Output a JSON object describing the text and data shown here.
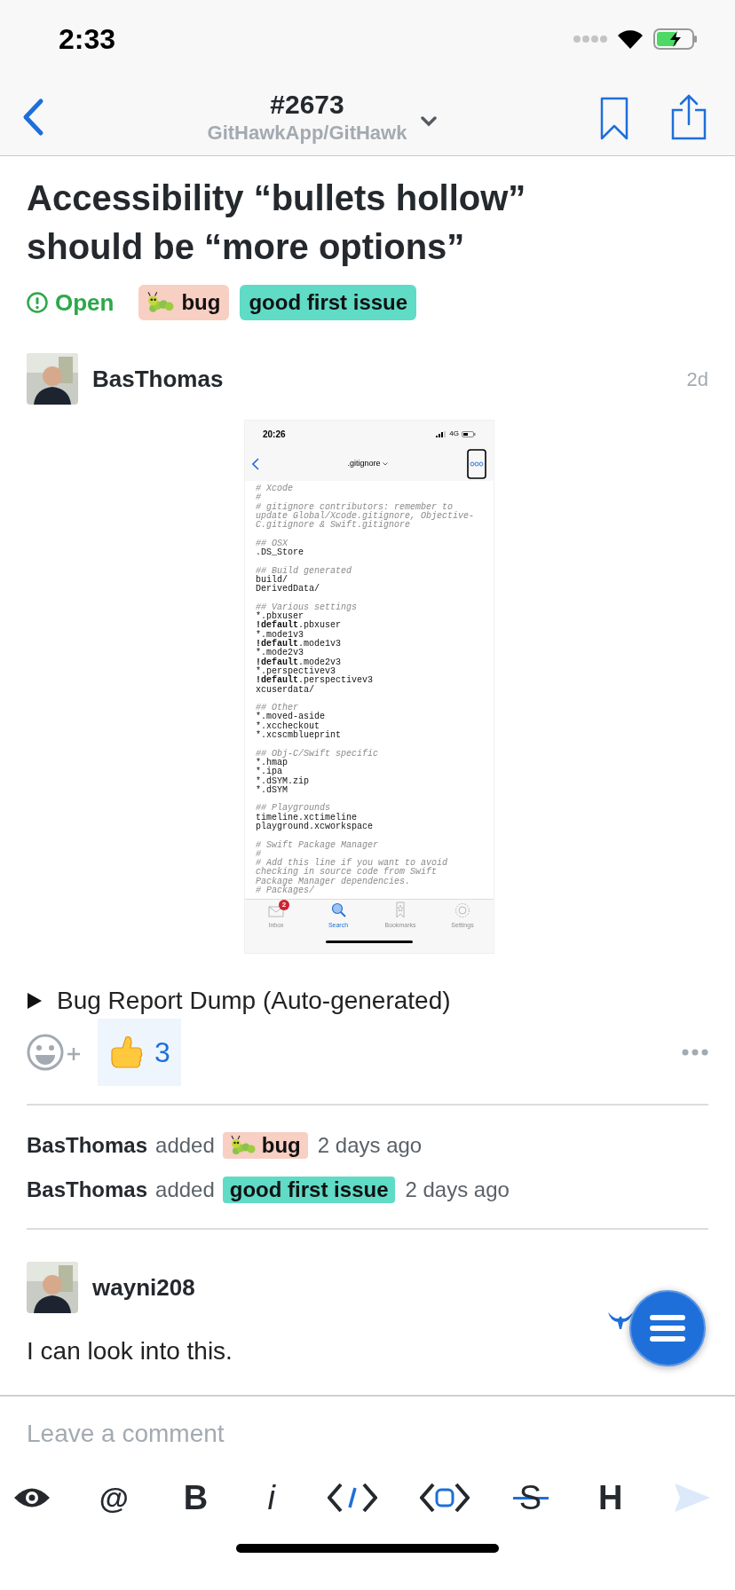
{
  "status_bar": {
    "time": "2:33"
  },
  "nav": {
    "title": "#2673",
    "subtitle": "GitHawkApp/GitHawk"
  },
  "issue": {
    "title": "Accessibility “bullets hollow” should be “more options”",
    "state": "Open",
    "labels": [
      {
        "name": "bug",
        "color": "#f8cfc3",
        "has_icon": true
      },
      {
        "name": "good first issue",
        "color": "#5fdbc6",
        "has_icon": false
      }
    ]
  },
  "comment": {
    "author": "BasThomas",
    "time": "2d",
    "screenshot": {
      "time": "20:26",
      "network": "4G",
      "title": ".gitignore",
      "code": [
        [
          {
            "kind": "comment",
            "text": "# Xcode"
          },
          {
            "kind": "comment",
            "text": "#"
          },
          {
            "kind": "comment",
            "text": "# gitignore contributors: remember to"
          },
          {
            "kind": "comment",
            "text": "update Global/Xcode.gitignore, Objective-"
          },
          {
            "kind": "comment",
            "text": "C.gitignore & Swift.gitignore"
          }
        ],
        [
          {
            "kind": "comment",
            "text": "## OSX"
          },
          {
            "kind": "code",
            "text": ".DS_Store"
          }
        ],
        [
          {
            "kind": "comment",
            "text": "## Build generated"
          },
          {
            "kind": "code",
            "text": "build/"
          },
          {
            "kind": "code",
            "text": "DerivedData/"
          }
        ],
        [
          {
            "kind": "comment",
            "text": "## Various settings"
          },
          {
            "kind": "code",
            "text": "*.pbxuser"
          },
          {
            "kind": "code",
            "bold": "!default",
            "text": ".pbxuser"
          },
          {
            "kind": "code",
            "text": "*.mode1v3"
          },
          {
            "kind": "code",
            "bold": "!default",
            "text": ".mode1v3"
          },
          {
            "kind": "code",
            "text": "*.mode2v3"
          },
          {
            "kind": "code",
            "bold": "!default",
            "text": ".mode2v3"
          },
          {
            "kind": "code",
            "text": "*.perspectivev3"
          },
          {
            "kind": "code",
            "bold": "!default",
            "text": ".perspectivev3"
          },
          {
            "kind": "code",
            "text": "xcuserdata/"
          }
        ],
        [
          {
            "kind": "comment",
            "text": "## Other"
          },
          {
            "kind": "code",
            "text": "*.moved-aside"
          },
          {
            "kind": "code",
            "text": "*.xccheckout"
          },
          {
            "kind": "code",
            "text": "*.xcscmblueprint"
          }
        ],
        [
          {
            "kind": "comment",
            "text": "## Obj-C/Swift specific"
          },
          {
            "kind": "code",
            "text": "*.hmap"
          },
          {
            "kind": "code",
            "text": "*.ipa"
          },
          {
            "kind": "code",
            "text": "*.dSYM.zip"
          },
          {
            "kind": "code",
            "text": "*.dSYM"
          }
        ],
        [
          {
            "kind": "comment",
            "text": "## Playgrounds"
          },
          {
            "kind": "code",
            "text": "timeline.xctimeline"
          },
          {
            "kind": "code",
            "text": "playground.xcworkspace"
          }
        ],
        [
          {
            "kind": "comment",
            "text": "# Swift Package Manager"
          },
          {
            "kind": "comment",
            "text": "#"
          },
          {
            "kind": "comment",
            "text": "# Add this line if you want to avoid"
          },
          {
            "kind": "comment",
            "text": "checking in source code from Swift"
          },
          {
            "kind": "comment",
            "text": "Package Manager dependencies."
          },
          {
            "kind": "comment",
            "text": "# Packages/"
          }
        ]
      ],
      "tabs": [
        {
          "label": "Inbox",
          "badge": "2",
          "selected": false
        },
        {
          "label": "Search",
          "selected": true
        },
        {
          "label": "Bookmarks",
          "selected": false
        },
        {
          "label": "Settings",
          "selected": false
        }
      ]
    },
    "details": "Bug Report Dump (Auto-generated)",
    "reactions": [
      {
        "count": "3"
      }
    ]
  },
  "events": [
    {
      "actor": "BasThomas",
      "action": "added",
      "label": {
        "name": "bug",
        "color": "#f8cfc3",
        "has_icon": true
      },
      "time": "2 days ago"
    },
    {
      "actor": "BasThomas",
      "action": "added",
      "label": {
        "name": "good first issue",
        "color": "#5fdbc6",
        "has_icon": false
      },
      "time": "2 days ago"
    }
  ],
  "reply": {
    "author": "wayni208",
    "body": "I can look into this."
  },
  "composer": {
    "placeholder": "Leave a comment",
    "toolbar": [
      {
        "kind": "preview"
      },
      {
        "kind": "plain",
        "label": "@"
      },
      {
        "kind": "bold",
        "label": "B"
      },
      {
        "kind": "italic",
        "label": "i"
      },
      {
        "kind": "code"
      },
      {
        "kind": "code_block"
      },
      {
        "kind": "strike",
        "label": "S"
      },
      {
        "kind": "bold",
        "label": "H"
      },
      {
        "kind": "send",
        "disabled": true
      }
    ]
  }
}
